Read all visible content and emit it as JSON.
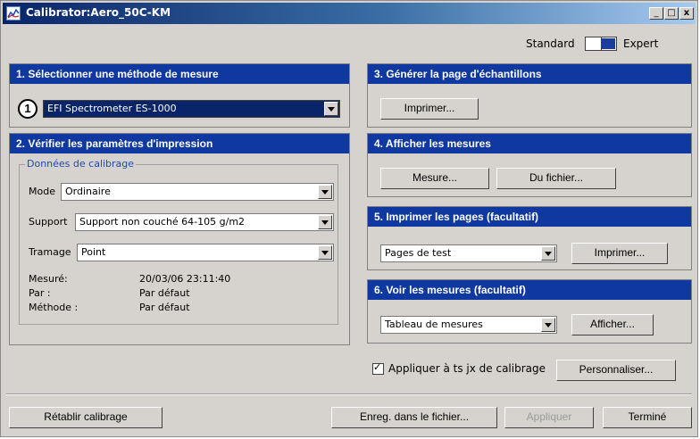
{
  "window": {
    "title": "Calibrator:Aero_50C-KM",
    "minimize": "_",
    "maximize": "□",
    "close": "x"
  },
  "mode": {
    "standard_label": "Standard",
    "expert_label": "Expert"
  },
  "panel1": {
    "title": "1. Sélectionner une méthode de mesure",
    "method_value": "EFI Spectrometer ES-1000",
    "badge": "1"
  },
  "panel2": {
    "title": "2. Vérifier les paramètres d'impression",
    "group_title": "Données de calibrage",
    "mode_label": "Mode",
    "mode_value": "Ordinaire",
    "support_label": "Support",
    "support_value": "Support non couché 64-105 g/m2",
    "tramage_label": "Tramage",
    "tramage_value": "Point",
    "measured_label": "Mesuré:",
    "measured_value": "20/03/06 23:11:40",
    "by_label": "Par :",
    "by_value": "Par défaut",
    "method_label": "Méthode :",
    "method_value": "Par défaut"
  },
  "panel3": {
    "title": "3. Générer la page d'échantillons",
    "print_button": "Imprimer..."
  },
  "panel4": {
    "title": "4. Afficher les mesures",
    "measure_button": "Mesure...",
    "file_button": "Du fichier..."
  },
  "panel5": {
    "title": "5. Imprimer les pages (facultatif)",
    "select_value": "Pages de test",
    "print_button": "Imprimer..."
  },
  "panel6": {
    "title": "6. Voir les mesures (facultatif)",
    "select_value": "Tableau de mesures",
    "show_button": "Afficher..."
  },
  "options": {
    "apply_all_label": "Appliquer à ts jx de calibrage",
    "customize_button": "Personnaliser..."
  },
  "footer": {
    "reset_button": "Rétablir calibrage",
    "save_button": "Enreg. dans le fichier...",
    "apply_button": "Appliquer",
    "done_button": "Terminé"
  }
}
